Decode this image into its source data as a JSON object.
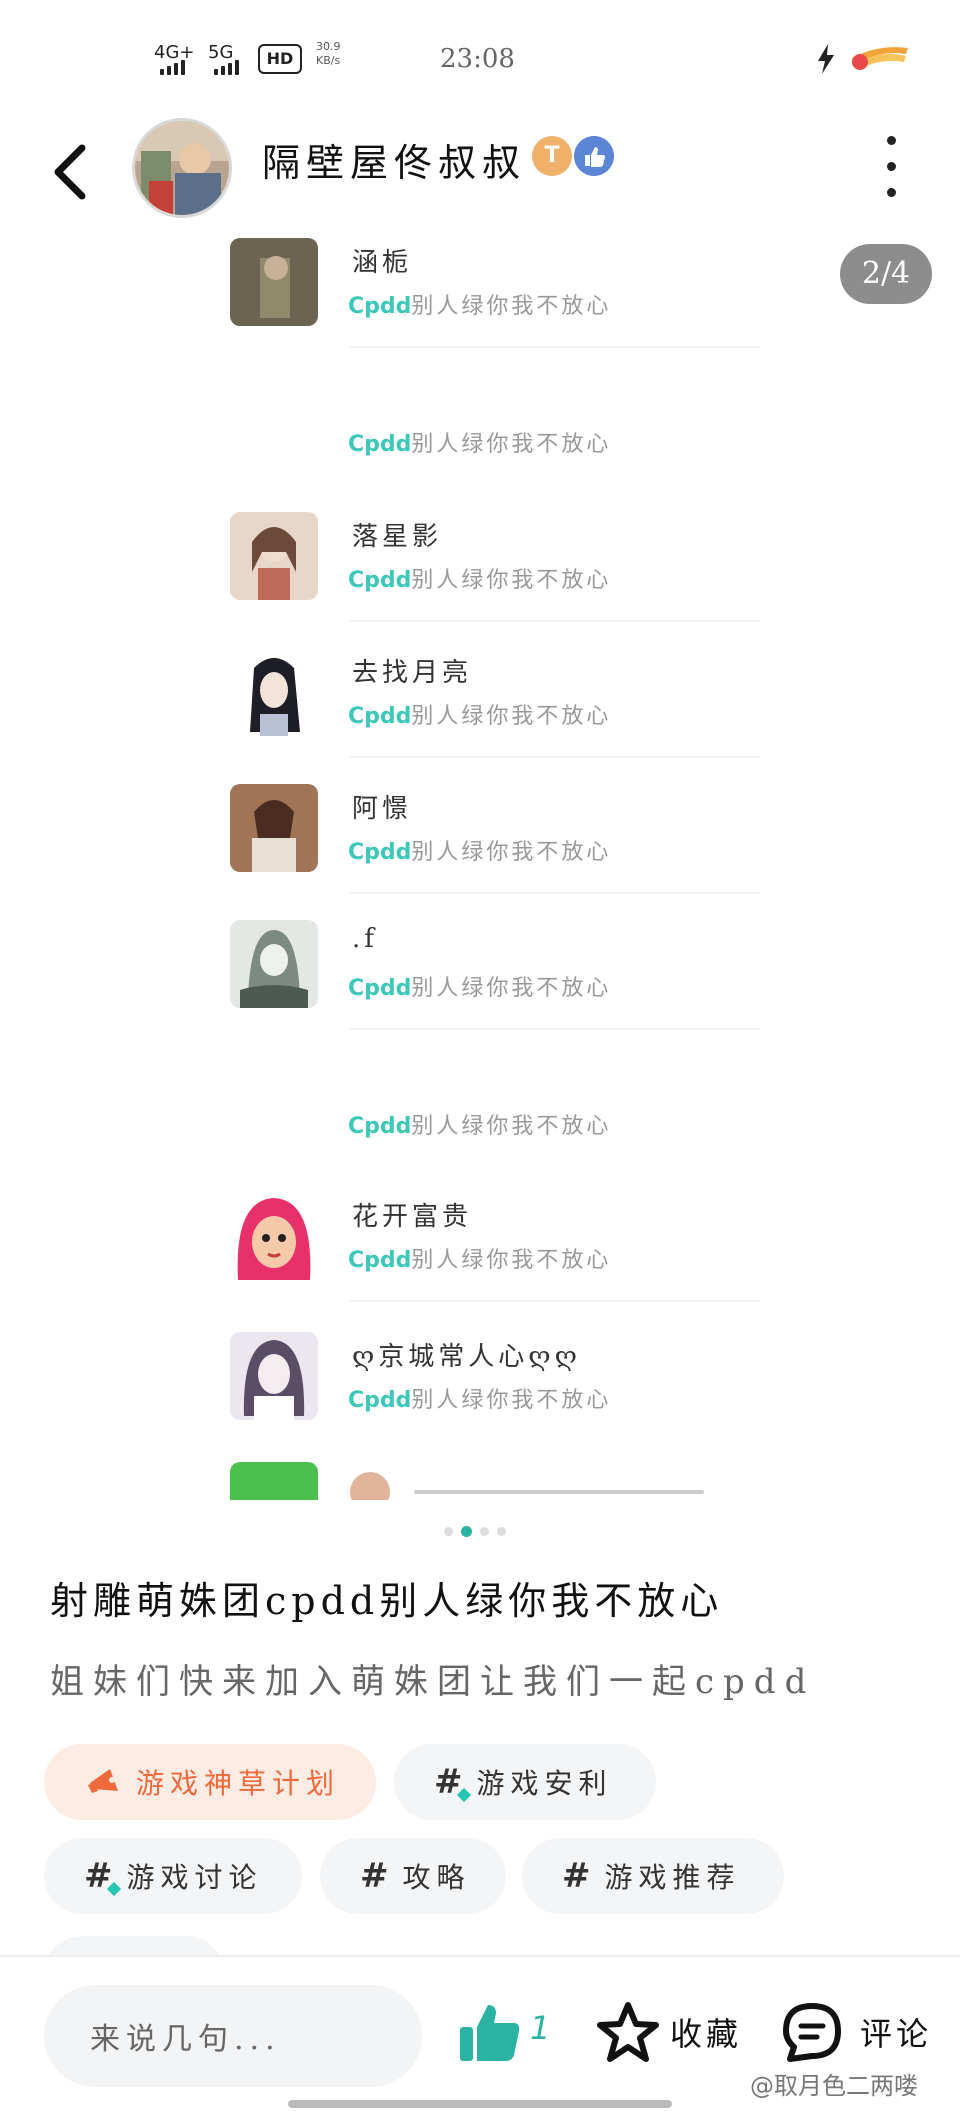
{
  "status_bar": {
    "net1": "4G+",
    "net2": "5G",
    "hd": "HD",
    "speed_value": "30.9",
    "speed_unit": "KB/s",
    "time": "23:08"
  },
  "header": {
    "user_name": "隔壁屋佟叔叔",
    "badge_t": "T"
  },
  "image": {
    "counter": "2/4",
    "cp_prefix": "Cpdd",
    "message": "别人绿你我不放心",
    "rows": [
      {
        "name": "涵栀"
      },
      {
        "name": "落星影"
      },
      {
        "name": "去找月亮"
      },
      {
        "name": "阿憬"
      },
      {
        "name": ".f"
      },
      {
        "name": "花开富贵"
      },
      {
        "name": "ღ京城常人心ღღ"
      }
    ]
  },
  "post": {
    "title": "射雕萌姝团cpdd别人绿你我不放心",
    "description": "姐妹们快来加入萌姝团让我们一起cpdd"
  },
  "tags": [
    {
      "label": "游戏神草计划"
    },
    {
      "label": "游戏安利"
    },
    {
      "label": "游戏讨论"
    },
    {
      "label": "攻略"
    },
    {
      "label": "游戏推荐"
    }
  ],
  "bottom_bar": {
    "comment_placeholder": "来说几句...",
    "like_count": "1",
    "favorite_label": "收藏",
    "comment_label": "评论"
  },
  "watermark": "@取月色二两喽",
  "colors": {
    "accent": "#2ab3a3",
    "cp_text": "#3ec8b8",
    "featured_tag_text": "#ee6a3a",
    "featured_tag_bg": "#fdece4"
  }
}
